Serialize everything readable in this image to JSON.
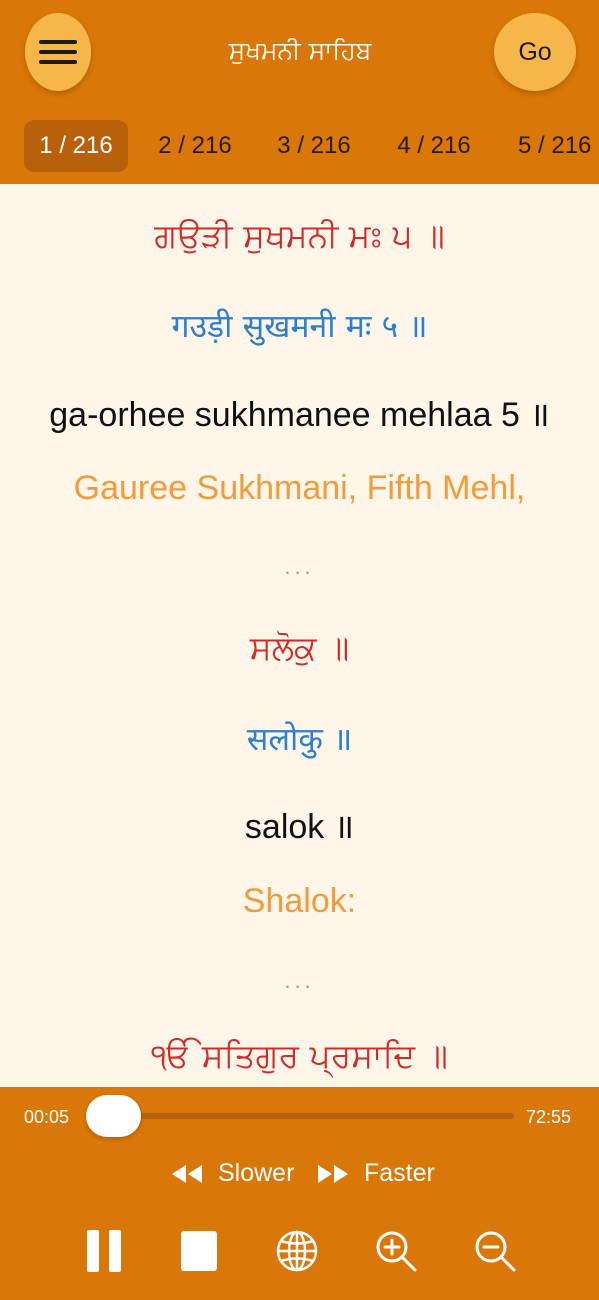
{
  "header": {
    "title": "ਸੁਖਮਨੀ ਸਾਹਿਬ",
    "go_label": "Go",
    "menu_icon": "hamburger-menu-icon",
    "pages": [
      "1 / 216",
      "2 / 216",
      "3 / 216",
      "4 / 216",
      "5 / 216"
    ],
    "active_page": 0
  },
  "content": {
    "verses": [
      {
        "gurmukhi": "ਗਉੜੀ ਸੁਖਮਨੀ ਮਃ ੫ ॥",
        "hindi": "गउड़ी सुखमनी मः ५ ॥",
        "transliteration": "ga-orhee sukhmanee mehlaa 5  ॥",
        "translation": "Gauree Sukhmani, Fifth Mehl,"
      },
      {
        "gurmukhi": "ਸਲੋਕੁ ॥",
        "hindi": "सलोकु ॥",
        "transliteration": "salok  ॥",
        "translation": "Shalok:"
      },
      {
        "gurmukhi": "ੴ ਸਤਿਗੁਰ ਪ੍ਰਸਾਦਿ ॥"
      }
    ],
    "separator": "..."
  },
  "player": {
    "current_time": "00:05",
    "total_time": "72:55",
    "slower_label": "Slower",
    "faster_label": "Faster",
    "progress_fraction": 0.001
  },
  "colors": {
    "primary": "#d97708",
    "button": "#f7b64a",
    "background": "#fdf6e9",
    "gurmukhi": "#d12a2a",
    "hindi": "#2f7fd0",
    "translation": "#f39a3a"
  }
}
